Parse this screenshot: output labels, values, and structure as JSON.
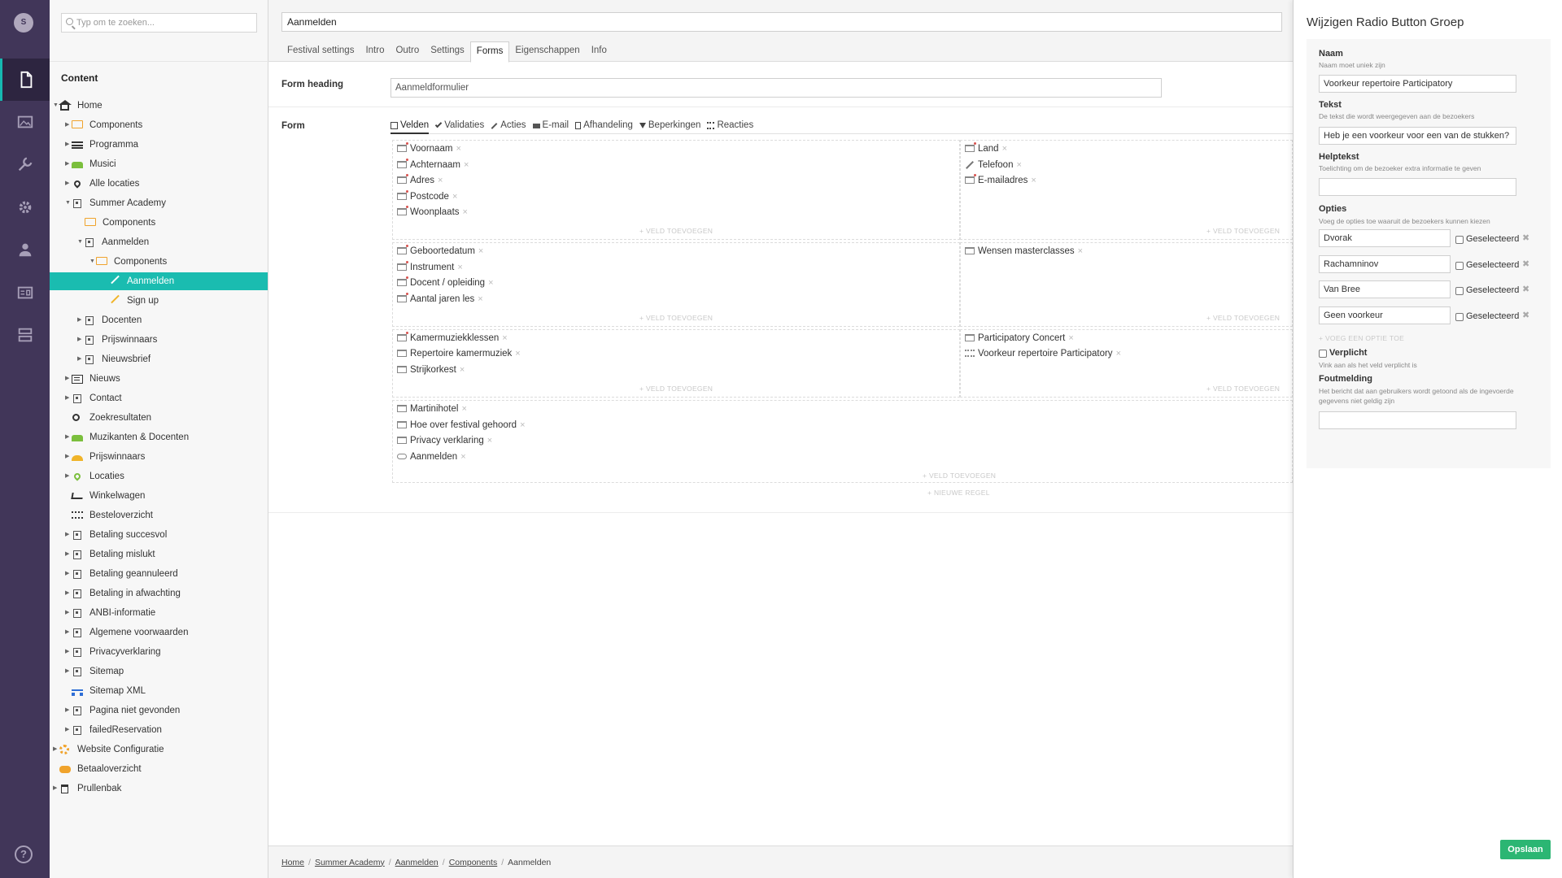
{
  "user": {
    "initial": "S"
  },
  "help": {
    "label": "?"
  },
  "tree": {
    "search_placeholder": "Typ om te zoeken...",
    "root": "Content",
    "items": [
      {
        "label": "Home"
      },
      {
        "label": "Components"
      },
      {
        "label": "Programma"
      },
      {
        "label": "Musici"
      },
      {
        "label": "Alle locaties"
      },
      {
        "label": "Summer Academy"
      },
      {
        "label": "Components"
      },
      {
        "label": "Aanmelden"
      },
      {
        "label": "Components"
      },
      {
        "label": "Aanmelden"
      },
      {
        "label": "Sign up"
      },
      {
        "label": "Docenten"
      },
      {
        "label": "Prijswinnaars"
      },
      {
        "label": "Nieuwsbrief"
      },
      {
        "label": "Nieuws"
      },
      {
        "label": "Contact"
      },
      {
        "label": "Zoekresultaten"
      },
      {
        "label": "Muzikanten & Docenten"
      },
      {
        "label": "Prijswinnaars"
      },
      {
        "label": "Locaties"
      },
      {
        "label": "Winkelwagen"
      },
      {
        "label": "Besteloverzicht"
      },
      {
        "label": "Betaling succesvol"
      },
      {
        "label": "Betaling mislukt"
      },
      {
        "label": "Betaling geannuleerd"
      },
      {
        "label": "Betaling in afwachting"
      },
      {
        "label": "ANBI-informatie"
      },
      {
        "label": "Algemene voorwaarden"
      },
      {
        "label": "Privacyverklaring"
      },
      {
        "label": "Sitemap"
      },
      {
        "label": "Sitemap XML"
      },
      {
        "label": "Pagina niet gevonden"
      },
      {
        "label": "failedReservation"
      },
      {
        "label": "Website Configuratie"
      },
      {
        "label": "Betaaloverzicht"
      },
      {
        "label": "Prullenbak"
      }
    ]
  },
  "editor": {
    "node_name": "Aanmelden",
    "tabs": [
      "Festival settings",
      "Intro",
      "Outro",
      "Settings",
      "Forms",
      "Eigenschappen",
      "Info"
    ],
    "form_heading_label": "Form heading",
    "form_heading_value": "Aanmeldformulier",
    "form_label": "Form",
    "form_tabs": [
      "Velden",
      "Validaties",
      "Acties",
      "E-mail",
      "Afhandeling",
      "Beperkingen",
      "Reacties"
    ],
    "rows": [
      {
        "left": [
          "Voornaam",
          "Achternaam",
          "Adres",
          "Postcode",
          "Woonplaats"
        ],
        "right": [
          "Land",
          "Telefoon",
          "E-mailadres"
        ]
      },
      {
        "left": [
          "Geboortedatum",
          "Instrument",
          "Docent / opleiding",
          "Aantal jaren les"
        ],
        "right": [
          "Wensen masterclasses"
        ]
      },
      {
        "left": [
          "Kamermuziekklessen",
          "Repertoire kamermuziek",
          "Strijkorkest"
        ],
        "right": [
          "Participatory Concert",
          "Voorkeur repertoire Participatory"
        ]
      },
      {
        "full": [
          "Martinihotel",
          "Hoe over festival gehoord",
          "Privacy verklaring",
          "Aanmelden"
        ]
      }
    ],
    "add_field": "VELD TOEVOEGEN",
    "new_row": "NIEUWE REGEL",
    "remove_symbol": "×",
    "breadcrumb": [
      "Home",
      "Summer Academy",
      "Aanmelden",
      "Components"
    ],
    "breadcrumb_current": "Aanmelden"
  },
  "panel": {
    "title": "Wijzigen Radio Button Groep",
    "naam_label": "Naam",
    "naam_desc": "Naam moet uniek zijn",
    "naam_value": "Voorkeur repertoire Participatory",
    "tekst_label": "Tekst",
    "tekst_desc": "De tekst die wordt weergegeven aan de bezoekers",
    "tekst_value": "Heb je een voorkeur voor een van de stukken?",
    "help_label": "Helptekst",
    "help_desc": "Toelichting om de bezoeker extra informatie te geven",
    "help_value": "",
    "opties_label": "Opties",
    "opties_desc": "Voeg de opties toe waaruit de bezoekers kunnen kiezen",
    "options": [
      {
        "value": "Dvorak",
        "selected_label": "Geselecteerd"
      },
      {
        "value": "Rachamninov",
        "selected_label": "Geselecteerd"
      },
      {
        "value": "Van Bree",
        "selected_label": "Geselecteerd"
      },
      {
        "value": "Geen voorkeur",
        "selected_label": "Geselecteerd"
      }
    ],
    "add_option": "VOEG EEN OPTIE TOE",
    "verplicht_label": "Verplicht",
    "verplicht_desc": "Vink aan als het veld verplicht is",
    "fout_label": "Foutmelding",
    "fout_desc": "Het bericht dat aan gebruikers wordt getoond als de ingevoerde gegevens niet geldig zijn",
    "fout_value": "",
    "save": "Opslaan"
  },
  "colors": {
    "appbar": "#413659",
    "accent": "#1abcb0",
    "save": "#2bb673"
  }
}
